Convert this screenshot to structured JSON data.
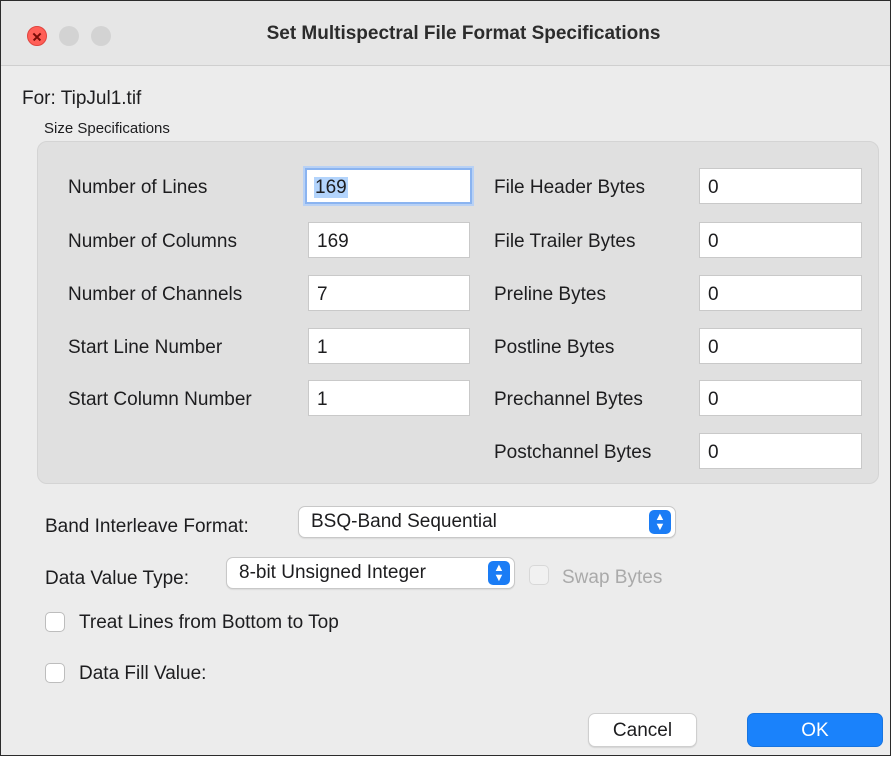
{
  "window": {
    "title": "Set Multispectral File Format Specifications"
  },
  "file": {
    "for_label": "For:",
    "file_name": "TipJul1.tif"
  },
  "size_specifications": {
    "caption": "Size Specifications",
    "left_fields": [
      {
        "label": "Number of Lines",
        "value": "169"
      },
      {
        "label": "Number of Columns",
        "value": "169"
      },
      {
        "label": "Number of Channels",
        "value": "7"
      },
      {
        "label": "Start Line Number",
        "value": "1"
      },
      {
        "label": "Start Column Number",
        "value": "1"
      }
    ],
    "right_fields": [
      {
        "label": "File Header Bytes",
        "value": "0"
      },
      {
        "label": "File Trailer Bytes",
        "value": "0"
      },
      {
        "label": "Preline Bytes",
        "value": "0"
      },
      {
        "label": "Postline Bytes",
        "value": "0"
      },
      {
        "label": "Prechannel Bytes",
        "value": "0"
      },
      {
        "label": "Postchannel Bytes",
        "value": "0"
      }
    ]
  },
  "band_interleave": {
    "label": "Band Interleave Format:",
    "selected": "BSQ-Band Sequential"
  },
  "data_value_type": {
    "label": "Data Value Type:",
    "selected": "8-bit Unsigned Integer"
  },
  "swap_bytes": {
    "label": "Swap Bytes",
    "checked": false,
    "enabled": false
  },
  "treat_lines": {
    "label": "Treat Lines from Bottom to Top",
    "checked": false
  },
  "data_fill": {
    "label": "Data Fill Value:",
    "checked": false
  },
  "buttons": {
    "cancel": "Cancel",
    "ok": "OK"
  },
  "colors": {
    "accent": "#1a82fb",
    "close": "#ff5f57",
    "panel": "#e0e0e0",
    "window_bg": "#ececec"
  }
}
